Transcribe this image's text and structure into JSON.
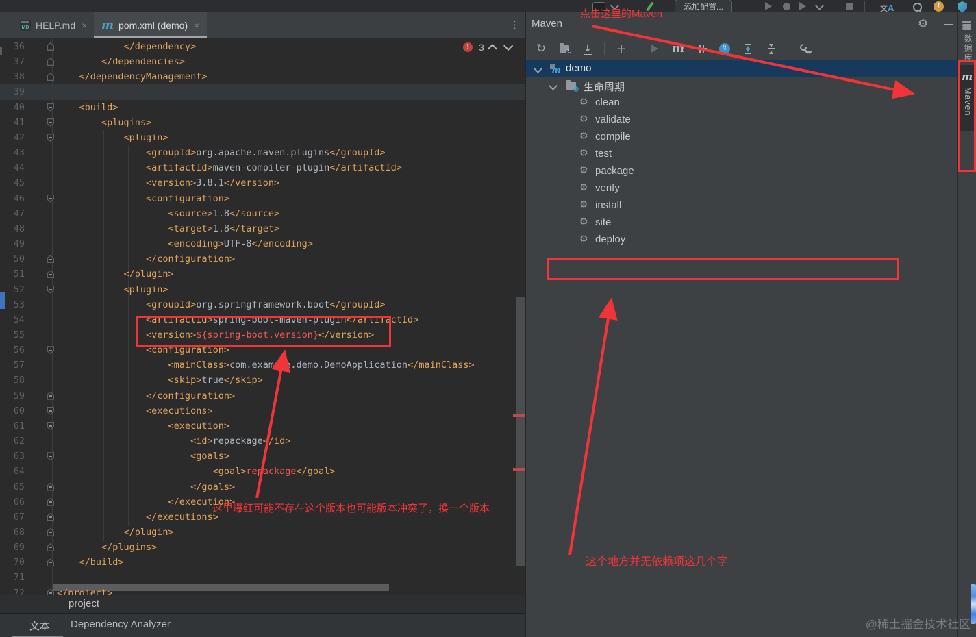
{
  "titlebar": {
    "add_config_label": "添加配置...",
    "translate_zh": "文",
    "translate_a": "A"
  },
  "tabs": {
    "help_label": "HELP.md",
    "pom_label": "pom.xml (demo)",
    "md_icon_text": "MD",
    "maven_icon_letter": "m",
    "close_glyph": "×",
    "kebab_glyph": "⋮"
  },
  "editor": {
    "error_count": "3",
    "breadcrumb": "project",
    "lines": [
      {
        "n": 36,
        "fold": "up",
        "segs": [
          [
            "t",
            "            </dependency>"
          ]
        ]
      },
      {
        "n": 37,
        "fold": "up",
        "segs": [
          [
            "t",
            "        </dependencies>"
          ]
        ]
      },
      {
        "n": 38,
        "fold": "up",
        "segs": [
          [
            "t",
            "    </dependencyManagement>"
          ]
        ]
      },
      {
        "n": 39,
        "hl": true,
        "segs": []
      },
      {
        "n": 40,
        "fold": "down",
        "segs": [
          [
            "t",
            "    <build>"
          ]
        ]
      },
      {
        "n": 41,
        "fold": "down",
        "segs": [
          [
            "t",
            "        <plugins>"
          ]
        ]
      },
      {
        "n": 42,
        "fold": "down",
        "segs": [
          [
            "t",
            "            <plugin>"
          ]
        ]
      },
      {
        "n": 43,
        "segs": [
          [
            "t",
            "                <groupId>"
          ],
          [
            "v",
            "org.apache.maven.plugins"
          ],
          [
            "t",
            "</groupId>"
          ]
        ]
      },
      {
        "n": 44,
        "segs": [
          [
            "t",
            "                <artifactId>"
          ],
          [
            "v",
            "maven-compiler-plugin"
          ],
          [
            "t",
            "</artifactId>"
          ]
        ]
      },
      {
        "n": 45,
        "segs": [
          [
            "t",
            "                <version>"
          ],
          [
            "v",
            "3.8.1"
          ],
          [
            "t",
            "</version>"
          ]
        ]
      },
      {
        "n": 46,
        "fold": "down",
        "segs": [
          [
            "t",
            "                <configuration>"
          ]
        ]
      },
      {
        "n": 47,
        "segs": [
          [
            "t",
            "                    <source>"
          ],
          [
            "v",
            "1.8"
          ],
          [
            "t",
            "</source>"
          ]
        ]
      },
      {
        "n": 48,
        "segs": [
          [
            "t",
            "                    <target>"
          ],
          [
            "v",
            "1.8"
          ],
          [
            "t",
            "</target>"
          ]
        ]
      },
      {
        "n": 49,
        "segs": [
          [
            "t",
            "                    <encoding>"
          ],
          [
            "v",
            "UTF-8"
          ],
          [
            "t",
            "</encoding>"
          ]
        ]
      },
      {
        "n": 50,
        "fold": "up",
        "segs": [
          [
            "t",
            "                </configuration>"
          ]
        ]
      },
      {
        "n": 51,
        "fold": "up",
        "segs": [
          [
            "t",
            "            </plugin>"
          ]
        ]
      },
      {
        "n": 52,
        "fold": "down",
        "segs": [
          [
            "t",
            "            <plugin>"
          ]
        ]
      },
      {
        "n": 53,
        "segs": [
          [
            "t",
            "                <groupId>"
          ],
          [
            "v",
            "org.springframework.boot"
          ],
          [
            "t",
            "</groupId>"
          ]
        ]
      },
      {
        "n": 54,
        "segs": [
          [
            "t",
            "                <artifactId>"
          ],
          [
            "v",
            "spring-boot-maven-plugin"
          ],
          [
            "t",
            "</artifactId>"
          ]
        ]
      },
      {
        "n": 55,
        "segs": [
          [
            "t",
            "                <version>"
          ],
          [
            "e",
            "${spring-boot.version}"
          ],
          [
            "t",
            "</version>"
          ]
        ]
      },
      {
        "n": 56,
        "fold": "down",
        "segs": [
          [
            "t",
            "                <configuration>"
          ]
        ]
      },
      {
        "n": 57,
        "segs": [
          [
            "t",
            "                    <mainClass>"
          ],
          [
            "v",
            "com.example.demo.DemoApplication"
          ],
          [
            "t",
            "</mainClass>"
          ]
        ]
      },
      {
        "n": 58,
        "segs": [
          [
            "t",
            "                    <skip>"
          ],
          [
            "v",
            "true"
          ],
          [
            "t",
            "</skip>"
          ]
        ]
      },
      {
        "n": 59,
        "fold": "up",
        "segs": [
          [
            "t",
            "                </configuration>"
          ]
        ]
      },
      {
        "n": 60,
        "fold": "down",
        "segs": [
          [
            "t",
            "                <executions>"
          ]
        ]
      },
      {
        "n": 61,
        "fold": "down",
        "segs": [
          [
            "t",
            "                    <execution>"
          ]
        ]
      },
      {
        "n": 62,
        "segs": [
          [
            "t",
            "                        <id>"
          ],
          [
            "v",
            "repackage"
          ],
          [
            "t",
            "</id>"
          ]
        ]
      },
      {
        "n": 63,
        "fold": "down",
        "segs": [
          [
            "t",
            "                        <goals>"
          ]
        ]
      },
      {
        "n": 64,
        "segs": [
          [
            "t",
            "                            <goal>"
          ],
          [
            "e",
            "repackage"
          ],
          [
            "t",
            "</goal>"
          ]
        ]
      },
      {
        "n": 65,
        "fold": "up",
        "segs": [
          [
            "t",
            "                        </goals>"
          ]
        ]
      },
      {
        "n": 66,
        "fold": "up",
        "segs": [
          [
            "t",
            "                    </execution>"
          ]
        ]
      },
      {
        "n": 67,
        "fold": "up",
        "segs": [
          [
            "t",
            "                </executions>"
          ]
        ]
      },
      {
        "n": 68,
        "fold": "up",
        "segs": [
          [
            "t",
            "            </plugin>"
          ]
        ]
      },
      {
        "n": 69,
        "fold": "up",
        "segs": [
          [
            "t",
            "        </plugins>"
          ]
        ]
      },
      {
        "n": 70,
        "fold": "up",
        "segs": [
          [
            "t",
            "    </build>"
          ]
        ]
      },
      {
        "n": 71,
        "segs": []
      },
      {
        "n": 72,
        "fold": "up",
        "segs": [
          [
            "t",
            "</project>"
          ]
        ]
      }
    ]
  },
  "bottombar": {
    "text_tab_label": "文本",
    "analyzer_label": "Dependency Analyzer"
  },
  "maven_panel": {
    "title": "Maven",
    "gear_glyph": "⚙",
    "tree": {
      "project_label": "demo",
      "lifecycle_label": "生命周期",
      "goals": [
        "clean",
        "validate",
        "compile",
        "test",
        "package",
        "verify",
        "install",
        "site",
        "deploy"
      ],
      "gear_glyph": "⚙"
    }
  },
  "right_stripe": {
    "database_label": "数据库",
    "maven_letter": "m",
    "maven_label": "Maven"
  },
  "annotations": {
    "color": "#f13438",
    "top_text": "点击这里的Maven",
    "editor_text": "这里爆红可能不存在这个版本也可能版本冲突了，换一个版本",
    "panel_text": "这个地方并无依赖项这几个字"
  },
  "watermark": "@稀土掘金技术社区",
  "colors": {
    "xml_tag": "#e0a35c",
    "xml_value": "#aeb5bd",
    "error_text": "#f3555a",
    "accent_blue": "#4a9fc9",
    "selection_row": "#17395c",
    "annotation_red": "#f13438",
    "editor_bg": "#2b2b2b",
    "panel_bg": "#3e4143"
  }
}
